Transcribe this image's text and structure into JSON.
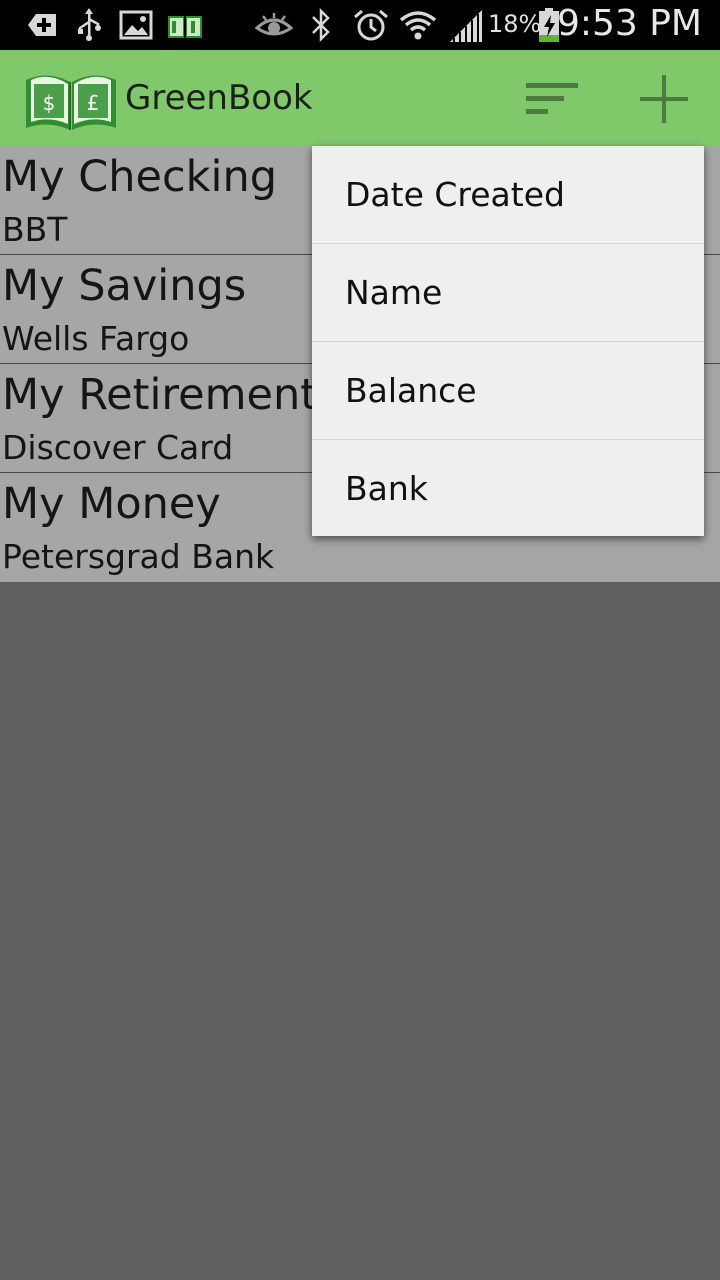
{
  "status_bar": {
    "icons_left": [
      "add-notification-icon",
      "usb-icon",
      "image-icon",
      "greenbook-notification-icon"
    ],
    "icons_right": [
      "eye-icon",
      "bluetooth-icon",
      "alarm-icon",
      "wifi-icon",
      "signal-icon",
      "battery-charging-icon"
    ],
    "battery_percent": "18%",
    "time": "9:53 PM"
  },
  "action_bar": {
    "title": "GreenBook",
    "background": "#80c96a",
    "actions": [
      "sort-icon",
      "add-icon"
    ]
  },
  "accounts": [
    {
      "name": "My Checking",
      "bank": "BBT"
    },
    {
      "name": "My Savings",
      "bank": "Wells Fargo"
    },
    {
      "name": "My Retirement",
      "bank": "Discover Card"
    },
    {
      "name": "My Money",
      "bank": "Petersgrad Bank"
    }
  ],
  "sort_menu": {
    "items": [
      "Date Created",
      "Name",
      "Balance",
      "Bank"
    ]
  }
}
